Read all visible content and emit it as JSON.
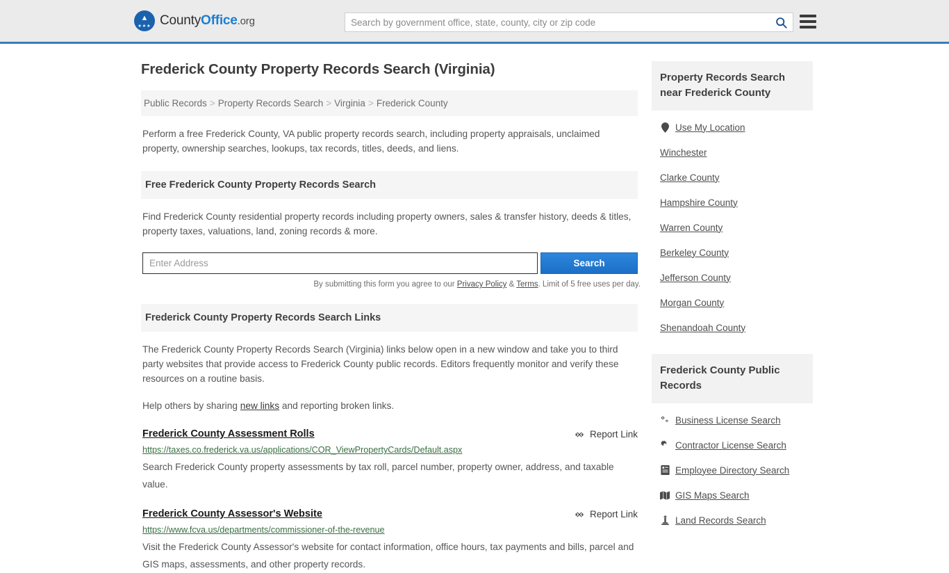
{
  "header": {
    "logo": {
      "part1": "County",
      "part2": "Office",
      "part3": ".org",
      "icon": "eagle-crest-icon"
    },
    "search_placeholder": "Search by government office, state, county, city or zip code",
    "search_value": "",
    "search_icon": "search-icon",
    "menu_icon": "hamburger-menu-icon"
  },
  "main": {
    "title": "Frederick County Property Records Search (Virginia)",
    "breadcrumb": [
      {
        "label": "Public Records"
      },
      {
        "label": "Property Records Search"
      },
      {
        "label": "Virginia"
      },
      {
        "label": "Frederick County"
      }
    ],
    "breadcrumb_separator": ">",
    "intro": "Perform a free Frederick County, VA public property records search, including property appraisals, unclaimed property, ownership searches, lookups, tax records, titles, deeds, and liens.",
    "free_search": {
      "heading": "Free Frederick County Property Records Search",
      "description": "Find Frederick County residential property records including property owners, sales & transfer history, deeds & titles, property taxes, valuations, land, zoning records & more.",
      "input_placeholder": "Enter Address",
      "input_value": "",
      "submit_label": "Search",
      "fineprint_pre": "By submitting this form you agree to our ",
      "privacy_label": "Privacy Policy",
      "fineprint_amp": " & ",
      "terms_label": "Terms",
      "fineprint_post": ". Limit of 5 free uses per day."
    },
    "links_section": {
      "heading": "Frederick County Property Records Search Links",
      "paragraph": "The Frederick County Property Records Search (Virginia) links below open in a new window and take you to third party websites that provide access to Frederick County public records. Editors frequently monitor and verify these resources on a routine basis.",
      "help_pre": "Help others by sharing ",
      "help_link": "new links",
      "help_post": " and reporting broken links.",
      "report_label": "Report Link",
      "report_icon": "broken-link-icon",
      "items": [
        {
          "title": "Frederick County Assessment Rolls",
          "url": "https://taxes.co.frederick.va.us/applications/COR_ViewPropertyCards/Default.aspx",
          "description": "Search Frederick County property assessments by tax roll, parcel number, property owner, address, and taxable value."
        },
        {
          "title": "Frederick County Assessor's Website",
          "url": "https://www.fcva.us/departments/commissioner-of-the-revenue",
          "description": "Visit the Frederick County Assessor's website for contact information, office hours, tax payments and bills, parcel and GIS maps, assessments, and other property records."
        }
      ]
    }
  },
  "sidebar": {
    "nearby": {
      "heading": "Property Records Search near Frederick County",
      "items": [
        {
          "label": "Use My Location",
          "icon": "map-pin-icon"
        },
        {
          "label": "Winchester",
          "icon": ""
        },
        {
          "label": "Clarke County",
          "icon": ""
        },
        {
          "label": "Hampshire County",
          "icon": ""
        },
        {
          "label": "Warren County",
          "icon": ""
        },
        {
          "label": "Berkeley County",
          "icon": ""
        },
        {
          "label": "Jefferson County",
          "icon": ""
        },
        {
          "label": "Morgan County",
          "icon": ""
        },
        {
          "label": "Shenandoah County",
          "icon": ""
        }
      ]
    },
    "public_records": {
      "heading": "Frederick County Public Records",
      "items": [
        {
          "label": "Business License Search",
          "icon": "cogs-icon"
        },
        {
          "label": "Contractor License Search",
          "icon": "gear-icon"
        },
        {
          "label": "Employee Directory Search",
          "icon": "list-book-icon"
        },
        {
          "label": "GIS Maps Search",
          "icon": "map-icon"
        },
        {
          "label": "Land Records Search",
          "icon": "landmark-icon"
        }
      ]
    }
  },
  "colors": {
    "brand_blue": "#1b7fd4",
    "header_border": "#3a7cb8",
    "header_bg": "#ebebeb",
    "panel_bg": "#f2f2f2",
    "url_green": "#3a7043",
    "button_blue": "#1b6fc6"
  }
}
